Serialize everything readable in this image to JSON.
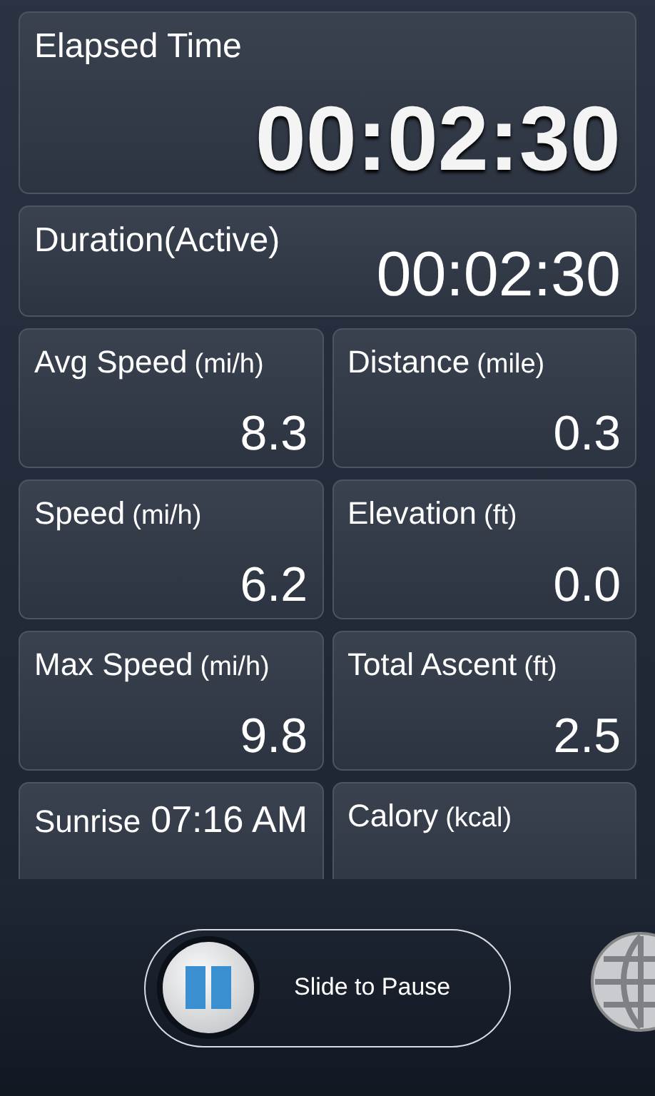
{
  "elapsed": {
    "label": "Elapsed Time",
    "value": "00:02:30"
  },
  "duration": {
    "label": "Duration(Active)",
    "value": "00:02:30"
  },
  "tiles": [
    {
      "label": "Avg Speed",
      "unit": "(mi/h)",
      "value": "8.3"
    },
    {
      "label": "Distance",
      "unit": "(mile)",
      "value": "0.3"
    },
    {
      "label": "Speed",
      "unit": "(mi/h)",
      "value": "6.2"
    },
    {
      "label": "Elevation",
      "unit": "(ft)",
      "value": "0.0"
    },
    {
      "label": "Max Speed",
      "unit": "(mi/h)",
      "value": "9.8"
    },
    {
      "label": "Total Ascent",
      "unit": "(ft)",
      "value": "2.5"
    },
    {
      "label": "Sunrise",
      "value": "07:16 AM",
      "kind": "inline"
    },
    {
      "label": "Calory",
      "unit": "(kcal)"
    }
  ],
  "slider": {
    "label": "Slide to Pause",
    "level": 0
  }
}
